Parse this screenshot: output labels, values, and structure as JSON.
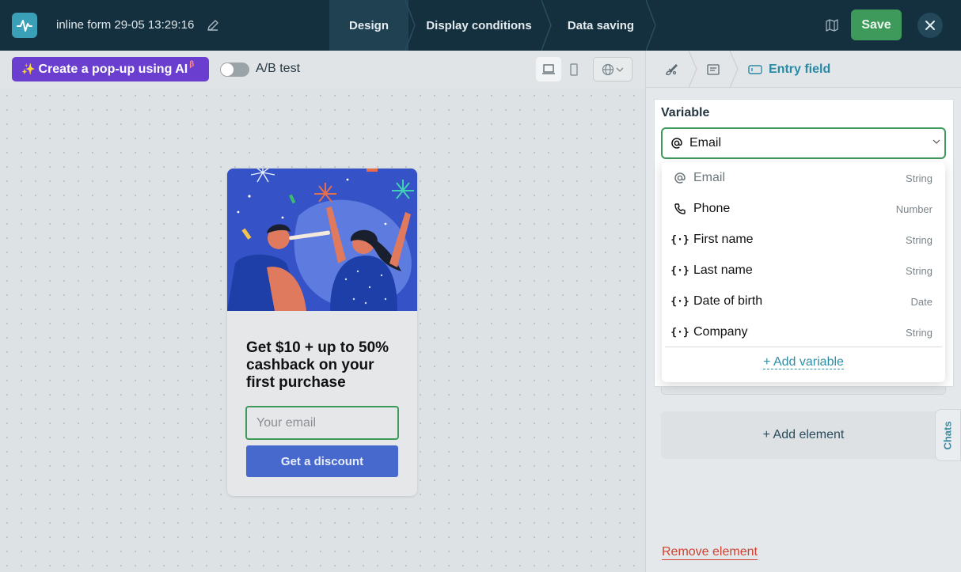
{
  "header": {
    "form_title": "inline form 29-05 13:29:16",
    "steps": [
      "Design",
      "Display conditions",
      "Data saving"
    ],
    "save_label": "Save",
    "icons": [
      "logo-icon",
      "pencil-icon",
      "map-icon",
      "close-icon"
    ]
  },
  "toolbar": {
    "ai_button": "Create a pop-up using AI",
    "ai_sup": "β",
    "ab_test_label": "A/B test",
    "ab_test_enabled": false
  },
  "popup": {
    "headline": "Get $10 + up to 50% cashback on your first purchase",
    "email_placeholder": "Your email",
    "button_label": "Get a discount"
  },
  "panel": {
    "breadcrumb_current": "Entry field",
    "variable_label": "Variable",
    "selected_variable": "Email",
    "options": [
      {
        "name": "Email",
        "type": "String",
        "icon": "at-icon"
      },
      {
        "name": "Phone",
        "type": "Number",
        "icon": "phone-icon"
      },
      {
        "name": "First name",
        "type": "String",
        "icon": "braces-icon"
      },
      {
        "name": "Last name",
        "type": "String",
        "icon": "braces-icon"
      },
      {
        "name": "Date of birth",
        "type": "Date",
        "icon": "braces-icon"
      },
      {
        "name": "Company",
        "type": "String",
        "icon": "braces-icon"
      }
    ],
    "add_variable": "+ Add variable",
    "add_element": "+ Add element",
    "remove_element": "Remove element",
    "chats_tab": "Chats"
  },
  "colors": {
    "topbar": "#14303f",
    "save": "#3d9a5a",
    "ai_button": "#6a3fd0",
    "accent": "#2e8fa8",
    "danger": "#d0422f",
    "popup_button": "#4768cc"
  }
}
